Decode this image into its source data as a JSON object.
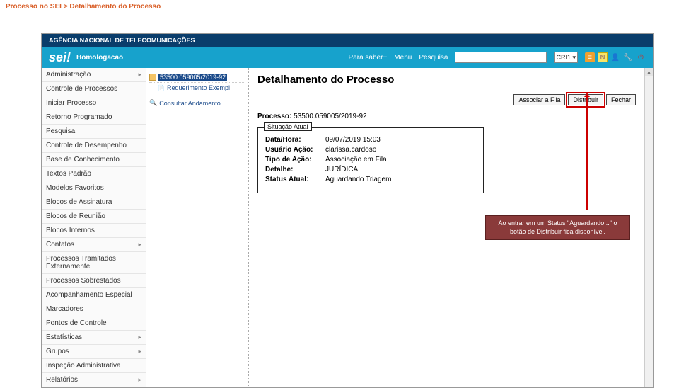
{
  "slide_title": "Processo no SEI > Detalhamento do Processo",
  "titlebar": "AGÊNCIA NACIONAL DE TELECOMUNICAÇÕES",
  "logo": "sei!",
  "env": "Homologacao",
  "top": {
    "know": "Para saber+",
    "menu": "Menu",
    "search": "Pesquisa",
    "scope": "CRI1",
    "placeholder": ""
  },
  "sidebar": [
    {
      "label": "Administração",
      "sub": true
    },
    {
      "label": "Controle de Processos",
      "sub": false
    },
    {
      "label": "Iniciar Processo",
      "sub": false
    },
    {
      "label": "Retorno Programado",
      "sub": false
    },
    {
      "label": "Pesquisa",
      "sub": false
    },
    {
      "label": "Controle de Desempenho",
      "sub": false
    },
    {
      "label": "Base de Conhecimento",
      "sub": false
    },
    {
      "label": "Textos Padrão",
      "sub": false
    },
    {
      "label": "Modelos Favoritos",
      "sub": false
    },
    {
      "label": "Blocos de Assinatura",
      "sub": false
    },
    {
      "label": "Blocos de Reunião",
      "sub": false
    },
    {
      "label": "Blocos Internos",
      "sub": false
    },
    {
      "label": "Contatos",
      "sub": true
    },
    {
      "label": "Processos Tramitados Externamente",
      "sub": false
    },
    {
      "label": "Processos Sobrestados",
      "sub": false
    },
    {
      "label": "Acompanhamento Especial",
      "sub": false
    },
    {
      "label": "Marcadores",
      "sub": false
    },
    {
      "label": "Pontos de Controle",
      "sub": false
    },
    {
      "label": "Estatísticas",
      "sub": true
    },
    {
      "label": "Grupos",
      "sub": true
    },
    {
      "label": "Inspeção Administrativa",
      "sub": false
    },
    {
      "label": "Relatórios",
      "sub": true
    }
  ],
  "tree": {
    "proc": "53500.059005/2019-92",
    "doc": "Requerimento Exempl",
    "consult": "Consultar Andamento"
  },
  "content": {
    "title": "Detalhamento do Processo",
    "btn_assoc": "Associar a Fila",
    "btn_dist": "Distribuir",
    "btn_close": "Fechar",
    "proc_label": "Processo:",
    "proc_num": "53500.059005/2019-92",
    "legend": "Situação Atual",
    "rows": [
      {
        "lbl": "Data/Hora:",
        "val": "09/07/2019 15:03"
      },
      {
        "lbl": "Usuário Ação:",
        "val": "clarissa.cardoso"
      },
      {
        "lbl": "Tipo de Ação:",
        "val": "Associação em Fila"
      },
      {
        "lbl": "Detalhe:",
        "val": "JURÍDICA"
      },
      {
        "lbl": "Status Atual:",
        "val": "Aguardando Triagem"
      }
    ]
  },
  "callout": "Ao entrar em um Status \"Aguardando...\" o botão de Distribuir fica disponível."
}
